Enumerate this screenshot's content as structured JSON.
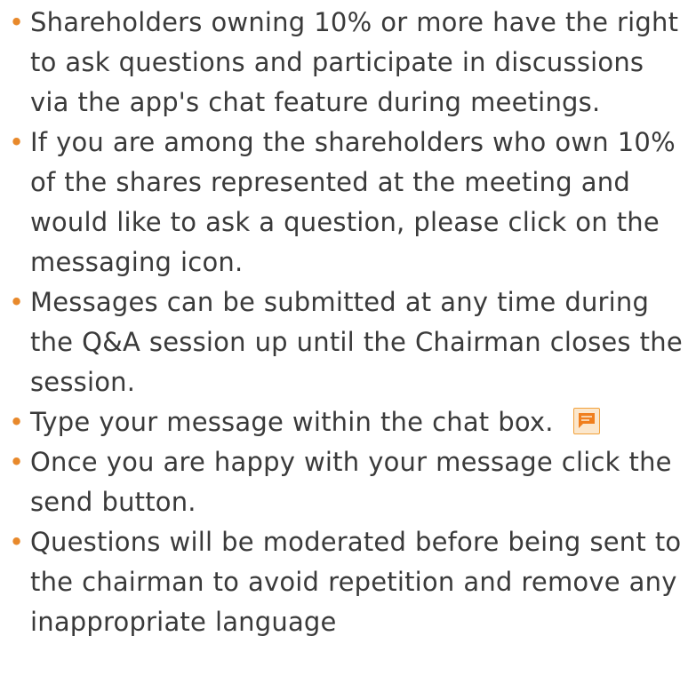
{
  "bullets": [
    {
      "text": "Shareholders owning 10% or more have the right to ask questions and participate in discussions via the app's chat feature during meetings."
    },
    {
      "text": "If you are among the shareholders who own 10% of the shares represented at the meeting and would like to ask a question, please click on the messaging icon."
    },
    {
      "text": "Messages can be submitted at any time during the Q&A session up until the Chairman closes the session."
    },
    {
      "text": "Type your message within the chat box.",
      "icon": "chat-bubble-icon"
    },
    {
      "text": "Once you are happy with your message click the send button."
    },
    {
      "text": "Questions will be moderated before being sent to the chairman to avoid repetition and remove any inappropriate language"
    }
  ],
  "colors": {
    "bullet": "#e8892b",
    "text": "#3a3a3a",
    "icon_fill": "#f07f1e",
    "icon_bg": "#fbe7cd"
  }
}
